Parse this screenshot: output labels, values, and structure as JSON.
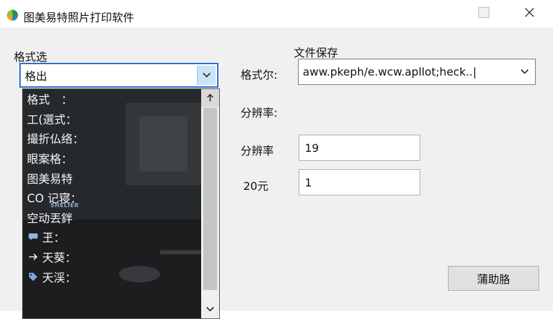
{
  "window": {
    "title": "图美易特照片打印软件",
    "app_icon": "pinwheel-app-icon",
    "maximize_icon": "maximize-icon",
    "close_icon": "close-icon"
  },
  "left_panel": {
    "group_label": "格式选",
    "format_combo": {
      "value": "格出",
      "arrow_icon": "chevron-down-icon"
    },
    "list": {
      "items": [
        {
          "label": "格式　：",
          "icon": ""
        },
        {
          "label": "工(選式：",
          "icon": ""
        },
        {
          "label": "撮折仏络：",
          "icon": ""
        },
        {
          "label": "眼案格：",
          "icon": ""
        },
        {
          "label": "图美易特",
          "icon": ""
        },
        {
          "label": "CO  记寝：",
          "icon": ""
        },
        {
          "label": "空动丟鉡",
          "icon": ""
        },
        {
          "label": "玊：",
          "icon": "speech-bubble-icon"
        },
        {
          "label": "天葵：",
          "icon": "arrow-right-icon"
        },
        {
          "label": "天渓：",
          "icon": "tag-icon"
        }
      ],
      "scroll_up_icon": "arrow-up-icon",
      "scroll_down_icon": "chevron-down-icon",
      "watermark": "SHELIER"
    }
  },
  "right_panel": {
    "save_label": "文件保存",
    "format_label": "格式尔:",
    "path_combo": {
      "value": "aww.pkeph/e.wcw.apllot;heck..|",
      "arrow_icon": "chevron-down-icon"
    },
    "resolution_heading": "分辨率:",
    "resolution_label": "分辨率",
    "resolution_value": "19",
    "yuan_label": "20元",
    "yuan_value": "1",
    "help_button": "蒲助胳"
  },
  "colors": {
    "accent": "#2b6dcf",
    "combo_arrow_bg": "#cce4f7",
    "dialog_bg": "#f0f0f0",
    "list_bg": "#202224"
  }
}
